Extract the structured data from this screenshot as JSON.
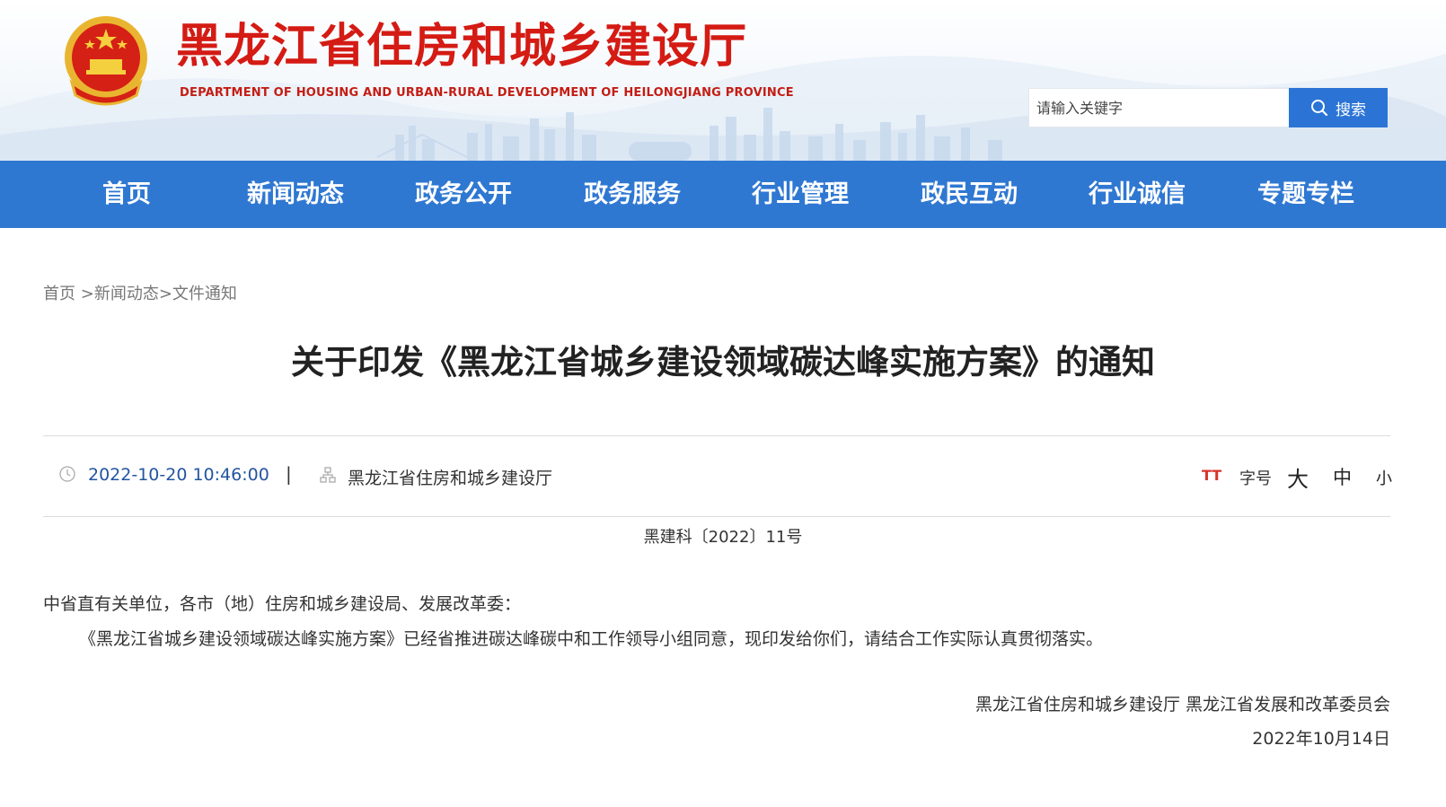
{
  "site": {
    "title": "黑龙江省住房和城乡建设厅",
    "subtitle": "DEPARTMENT OF HOUSING AND URBAN-RURAL DEVELOPMENT OF HEILONGJIANG PROVINCE"
  },
  "search": {
    "placeholder": "请输入关键字",
    "button_label": "搜索"
  },
  "nav": {
    "items": [
      {
        "label": "首页"
      },
      {
        "label": "新闻动态"
      },
      {
        "label": "政务公开"
      },
      {
        "label": "政务服务"
      },
      {
        "label": "行业管理"
      },
      {
        "label": "政民互动"
      },
      {
        "label": "行业诚信"
      },
      {
        "label": "专题专栏"
      }
    ]
  },
  "breadcrumb": {
    "items": [
      "首页",
      ">新闻动态",
      ">文件通知"
    ]
  },
  "article": {
    "title": "关于印发《黑龙江省城乡建设领域碳达峰实施方案》的通知",
    "date": "2022-10-20 10:46:00",
    "separator": "|",
    "source": "黑龙江省住房和城乡建设厅",
    "font_size": {
      "icon": "TT",
      "label": "字号",
      "large": "大",
      "medium": "中",
      "small": "小"
    },
    "doc_number": "黑建科〔2022〕11号",
    "salutation": "中省直有关单位，各市（地）住房和城乡建设局、发展改革委：",
    "paragraph": "《黑龙江省城乡建设领域碳达峰实施方案》已经省推进碳达峰碳中和工作领导小组同意，现印发给你们，请结合工作实际认真贯彻落实。",
    "signature": "黑龙江省住房和城乡建设厅 黑龙江省发展和改革委员会",
    "sign_date": "2022年10月14日"
  },
  "colors": {
    "brand_red": "#d41b14",
    "nav_blue": "#2f78d2",
    "search_blue": "#2b74d6",
    "date_blue": "#2355a0"
  },
  "icons": [
    "national-emblem-icon",
    "search-icon",
    "clock-icon",
    "org-icon",
    "font-size-icon"
  ]
}
